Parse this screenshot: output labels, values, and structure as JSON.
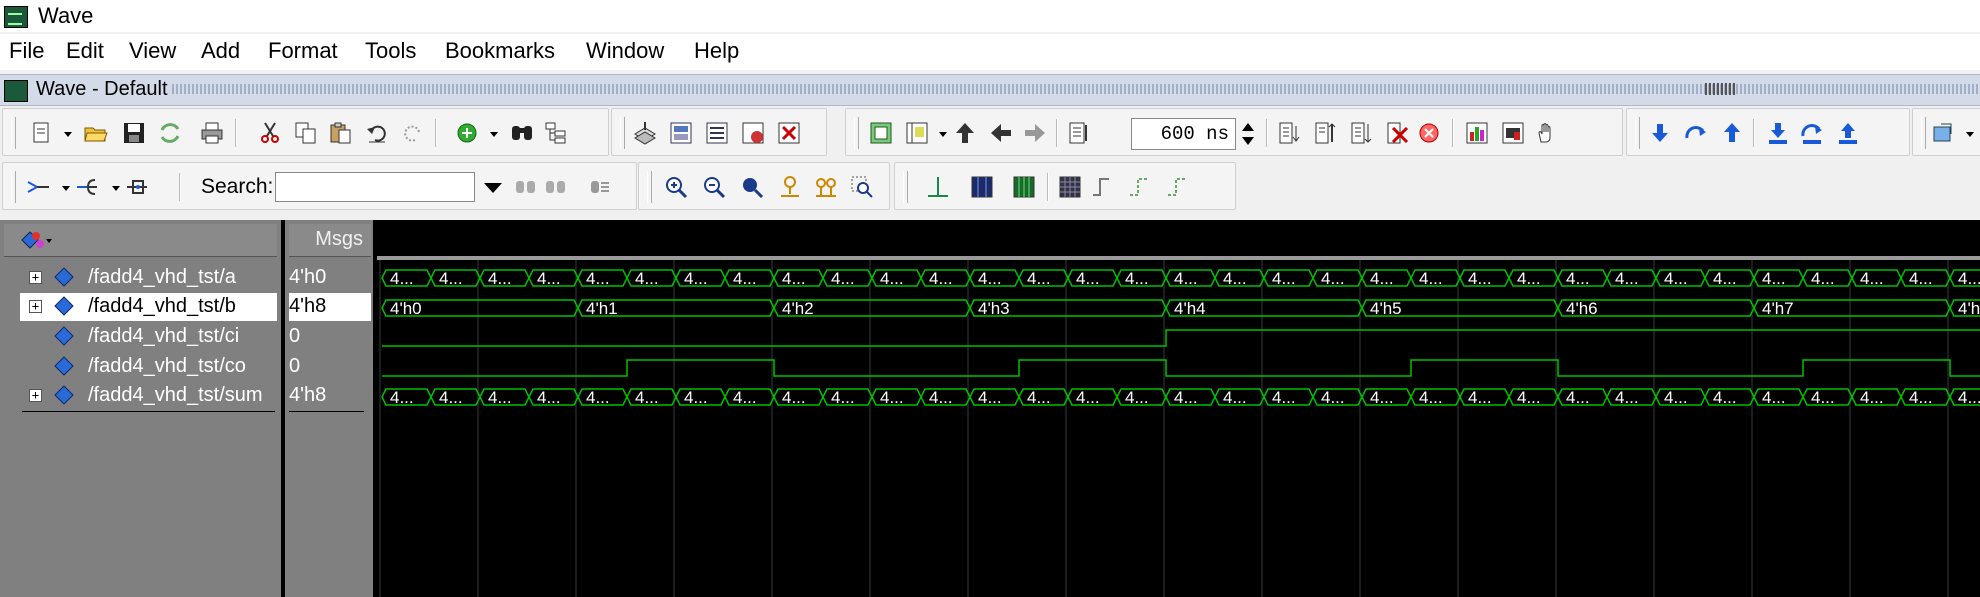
{
  "window": {
    "title": "Wave",
    "icon": "wave-app-icon"
  },
  "menu": [
    "File",
    "Edit",
    "View",
    "Add",
    "Format",
    "Tools",
    "Bookmarks",
    "Window",
    "Help"
  ],
  "panel": {
    "title": "Wave - Default"
  },
  "toolbar": {
    "search_label": "Search:",
    "search_value": "",
    "time_value": "600 ns"
  },
  "wave": {
    "values_header": "Msgs",
    "signals": [
      {
        "name": "/fadd4_vhd_tst/a",
        "value": "4'h0",
        "bus": true,
        "selected": false
      },
      {
        "name": "/fadd4_vhd_tst/b",
        "value": "4'h8",
        "bus": true,
        "selected": true
      },
      {
        "name": "/fadd4_vhd_tst/ci",
        "value": "0",
        "bus": false,
        "selected": false
      },
      {
        "name": "/fadd4_vhd_tst/co",
        "value": "0",
        "bus": false,
        "selected": false
      },
      {
        "name": "/fadd4_vhd_tst/sum",
        "value": "4'h8",
        "bus": true,
        "selected": false
      }
    ],
    "a_label": "4...",
    "sum_label": "4...",
    "b_labels": [
      "4'h0",
      "4'h1",
      "4'h2",
      "4'h3",
      "4'h4",
      "4'h5",
      "4'h6",
      "4'h7",
      "4'h"
    ],
    "ci_levels": [
      0,
      0,
      0,
      0,
      1,
      1,
      1,
      1,
      1
    ],
    "co_levels": [
      0,
      0,
      0,
      0,
      0,
      0,
      0,
      0,
      0,
      0,
      1,
      1,
      1,
      1,
      1,
      1,
      1,
      1,
      1,
      1,
      1,
      1,
      1,
      1,
      1,
      1,
      1,
      1,
      1,
      1,
      1,
      1,
      1,
      1,
      1,
      1,
      1,
      1,
      1,
      1
    ],
    "colors": {
      "wave": "#00c000",
      "text": "#ffffff",
      "grid": "#3a3a3a",
      "background": "#000000"
    }
  }
}
